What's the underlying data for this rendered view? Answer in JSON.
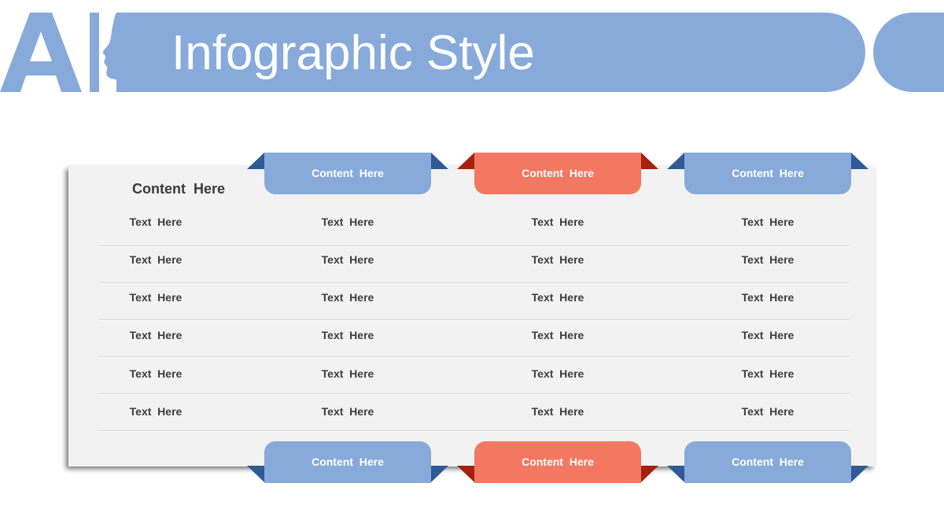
{
  "header": {
    "logo_text": "AI",
    "title": "Infographic Style"
  },
  "colors": {
    "accent_blue": "#87AADB",
    "accent_red": "#F47761",
    "fold_blue": "#2E5A96",
    "fold_red": "#A8200E",
    "panel_bg": "#F2F2F2"
  },
  "panel": {
    "title": "Content  Here",
    "top_tabs": [
      "Content  Here",
      "Content  Here",
      "Content  Here"
    ],
    "bottom_tabs": [
      "Content  Here",
      "Content  Here",
      "Content  Here"
    ],
    "rows": [
      [
        "Text  Here",
        "Text  Here",
        "Text  Here",
        "Text  Here"
      ],
      [
        "Text  Here",
        "Text  Here",
        "Text  Here",
        "Text  Here"
      ],
      [
        "Text  Here",
        "Text  Here",
        "Text  Here",
        "Text  Here"
      ],
      [
        "Text  Here",
        "Text  Here",
        "Text  Here",
        "Text  Here"
      ],
      [
        "Text  Here",
        "Text  Here",
        "Text  Here",
        "Text  Here"
      ],
      [
        "Text  Here",
        "Text  Here",
        "Text  Here",
        "Text  Here"
      ]
    ]
  }
}
